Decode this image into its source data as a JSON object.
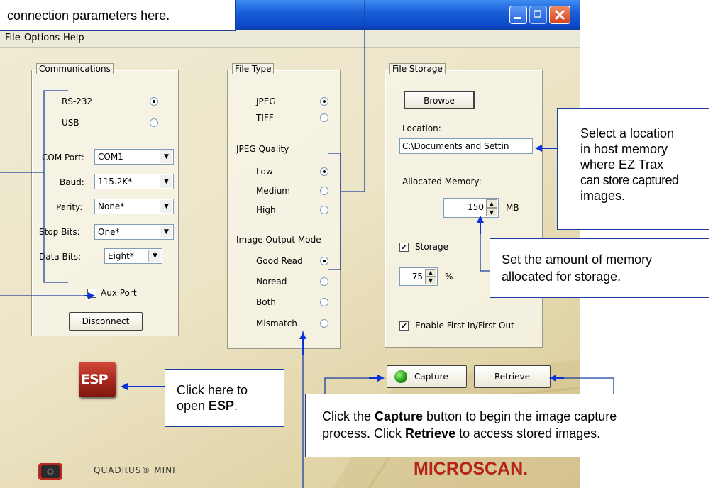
{
  "callouts": {
    "top": "connection parameters here.",
    "location_line1": "Select a location",
    "location_line2": "in host memory",
    "location_line3": "where EZ Trax",
    "location_line4": "can store captured",
    "location_line5": "images.",
    "memory_line1": "Set the amount of memory",
    "memory_line2": "allocated for storage.",
    "esp_line1": "Click here to",
    "esp_line2_prefix": "open ",
    "esp_line2_bold": "ESP",
    "esp_line2_suffix": ".",
    "capture_line1_prefix": "Click the ",
    "capture_line1_bold": "Capture",
    "capture_line1_suffix": " button to begin the image capture",
    "capture_line2_prefix": "process. Click ",
    "capture_line2_bold": "Retrieve",
    "capture_line2_suffix": " to access stored images."
  },
  "menu": [
    "File",
    "Options",
    "Help"
  ],
  "communications": {
    "title": "Communications",
    "rs232": "RS-232",
    "usb": "USB",
    "selected": "RS-232",
    "com_port_label": "COM Port:",
    "com_port_value": "COM1",
    "baud_label": "Baud:",
    "baud_value": "115.2K*",
    "parity_label": "Parity:",
    "parity_value": "None*",
    "stop_bits_label": "Stop Bits:",
    "stop_bits_value": "One*",
    "data_bits_label": "Data Bits:",
    "data_bits_value": "Eight*",
    "aux_port_label": "Aux Port",
    "aux_port_checked": false,
    "disconnect": "Disconnect"
  },
  "file_type": {
    "title": "File Type",
    "jpeg": "JPEG",
    "tiff": "TIFF",
    "selected_type": "JPEG",
    "quality_title": "JPEG Quality",
    "low": "Low",
    "medium": "Medium",
    "high": "High",
    "selected_quality": "Low",
    "output_title": "Image Output Mode",
    "good_read": "Good Read",
    "noread": "Noread",
    "both": "Both",
    "mismatch": "Mismatch",
    "selected_mode": "Good Read"
  },
  "file_storage": {
    "title": "File Storage",
    "browse": "Browse",
    "location_label": "Location:",
    "location_value": "C:\\Documents and Settin",
    "allocated_label": "Allocated Memory:",
    "allocated_value": "150",
    "allocated_unit": "MB",
    "storage_label": "Storage",
    "storage_checked": true,
    "percent_value": "75",
    "percent_unit": "%",
    "fifo_label": "Enable First In/First Out",
    "fifo_checked": true
  },
  "actions": {
    "capture": "Capture",
    "retrieve": "Retrieve"
  },
  "branding": {
    "esp_logo": "ESP",
    "product": "QUADRUS® MINI",
    "company": "MICROSCAN."
  },
  "colors": {
    "titlebar": "#0a4ac8",
    "close_button": "#e2512a",
    "callout_border": "#1c3f9e",
    "arrow": "#0b31d8",
    "brand_red": "#b6231b"
  }
}
